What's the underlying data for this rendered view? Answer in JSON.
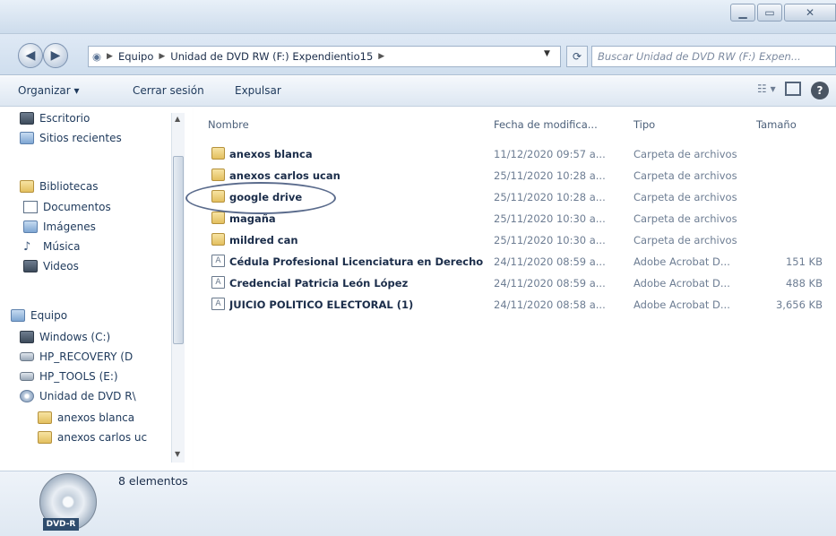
{
  "window": {
    "minimize_label": "▁",
    "maximize_label": "▭",
    "close_label": "✕"
  },
  "address_bar": {
    "segments": [
      "Equipo",
      "Unidad de DVD RW (F:) Expendientio15"
    ],
    "search_placeholder": "Buscar Unidad de DVD RW (F:) Expen..."
  },
  "toolbar": {
    "organize_label": "Organizar ▾",
    "close_session_label": "Cerrar sesión",
    "eject_label": "Expulsar"
  },
  "nav_pane": {
    "items": [
      {
        "label": "Escritorio",
        "icon": "desktop-icon"
      },
      {
        "label": "Sitios recientes",
        "icon": "recent-places-icon"
      },
      {
        "label": "Bibliotecas",
        "icon": "libraries-icon"
      },
      {
        "label": "Documentos",
        "icon": "documents-icon"
      },
      {
        "label": "Imágenes",
        "icon": "pictures-icon"
      },
      {
        "label": "Música",
        "icon": "music-icon"
      },
      {
        "label": "Videos",
        "icon": "videos-icon"
      },
      {
        "label": "Equipo",
        "icon": "computer-icon"
      },
      {
        "label": "Windows (C:)",
        "icon": "drive-icon"
      },
      {
        "label": "HP_RECOVERY (D",
        "icon": "drive-icon"
      },
      {
        "label": "HP_TOOLS (E:)",
        "icon": "drive-icon"
      },
      {
        "label": "Unidad de DVD R\\",
        "icon": "dvd-drive-icon"
      },
      {
        "label": "anexos blanca",
        "icon": "folder-icon"
      },
      {
        "label": "anexos carlos uc",
        "icon": "folder-icon"
      }
    ]
  },
  "columns": {
    "name": "Nombre",
    "date": "Fecha de modifica...",
    "type": "Tipo",
    "size": "Tamaño"
  },
  "files": [
    {
      "name": "anexos blanca",
      "date": "11/12/2020 09:57 a...",
      "type": "Carpeta de archivos",
      "size": "",
      "icon": "folder-icon"
    },
    {
      "name": "anexos carlos ucan",
      "date": "25/11/2020 10:28 a...",
      "type": "Carpeta de archivos",
      "size": "",
      "icon": "folder-icon"
    },
    {
      "name": "google drive",
      "date": "25/11/2020 10:28 a...",
      "type": "Carpeta de archivos",
      "size": "",
      "icon": "folder-icon"
    },
    {
      "name": "magaña",
      "date": "25/11/2020 10:30 a...",
      "type": "Carpeta de archivos",
      "size": "",
      "icon": "folder-icon"
    },
    {
      "name": "mildred can",
      "date": "25/11/2020 10:30 a...",
      "type": "Carpeta de archivos",
      "size": "",
      "icon": "folder-icon"
    },
    {
      "name": "Cédula Profesional Licenciatura en Derecho",
      "date": "24/11/2020 08:59 a...",
      "type": "Adobe Acrobat D...",
      "size": "151 KB",
      "icon": "pdf-icon"
    },
    {
      "name": "Credencial Patricia León López",
      "date": "24/11/2020 08:59 a...",
      "type": "Adobe Acrobat D...",
      "size": "488 KB",
      "icon": "pdf-icon"
    },
    {
      "name": "JUICIO POLITICO ELECTORAL (1)",
      "date": "24/11/2020 08:58 a...",
      "type": "Adobe Acrobat D...",
      "size": "3,656 KB",
      "icon": "pdf-icon"
    }
  ],
  "details": {
    "item_count": "8 elementos",
    "disc_label": "DVD-R"
  }
}
